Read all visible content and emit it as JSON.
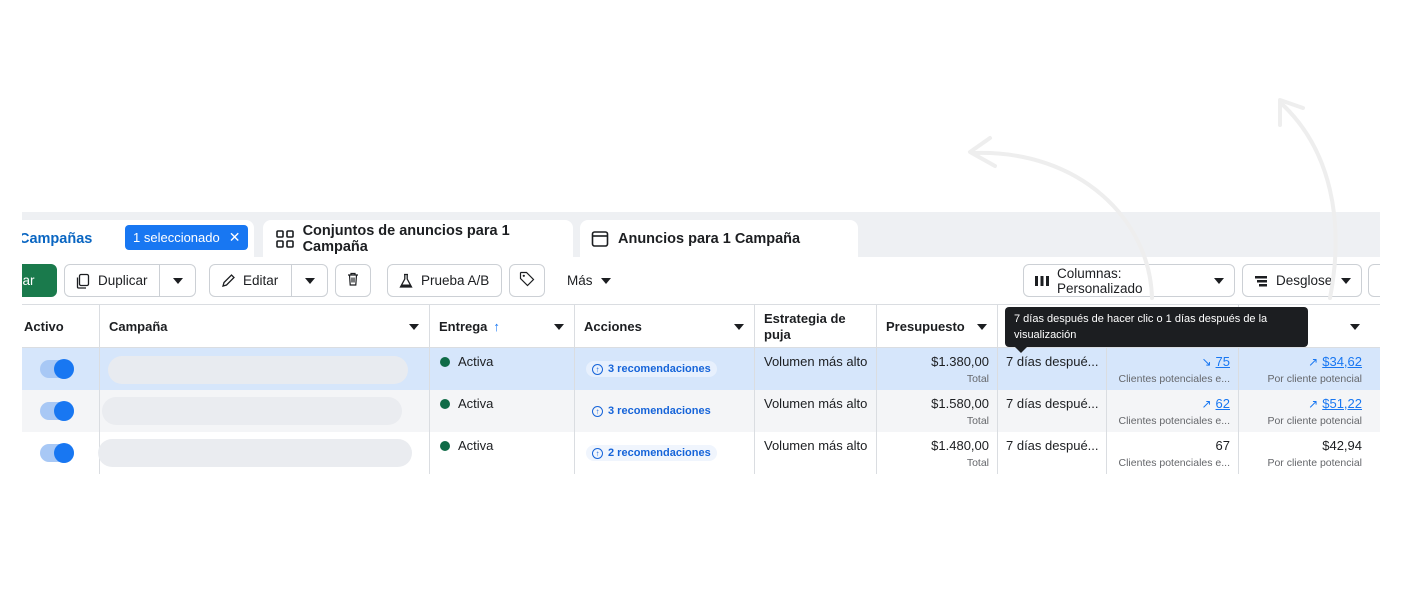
{
  "tabs": {
    "campaigns": "Campañas",
    "selected_badge": "1 seleccionado",
    "adsets": "Conjuntos de anuncios para 1 Campaña",
    "ads": "Anuncios para 1 Campaña"
  },
  "toolbar": {
    "create": "ear",
    "duplicate": "Duplicar",
    "edit": "Editar",
    "ab_test": "Prueba A/B",
    "more": "Más",
    "columns": "Columnas: Personalizado",
    "breakdown": "Desglose"
  },
  "table": {
    "headers": {
      "active": "Activo",
      "campaign": "Campaña",
      "delivery": "Entrega",
      "actions": "Acciones",
      "bid_strategy": "Estrategia de puja",
      "budget": "Presupuesto"
    },
    "rows": [
      {
        "delivery": "Activa",
        "actions": "3 recomendaciones",
        "bid": "Volumen más alto",
        "budget": "$1.380,00",
        "budget_sub": "Total",
        "attribution": "7 días despué...",
        "results": "75",
        "results_sub": "Clientes potenciales e...",
        "cost": "$34,62",
        "cost_sub": "Por cliente potencial"
      },
      {
        "delivery": "Activa",
        "actions": "3 recomendaciones",
        "bid": "Volumen más alto",
        "budget": "$1.580,00",
        "budget_sub": "Total",
        "attribution": "7 días despué...",
        "results": "62",
        "results_sub": "Clientes potenciales e...",
        "cost": "$51,22",
        "cost_sub": "Por cliente potencial"
      },
      {
        "delivery": "Activa",
        "actions": "2 recomendaciones",
        "bid": "Volumen más alto",
        "budget": "$1.480,00",
        "budget_sub": "Total",
        "attribution": "7 días despué...",
        "results": "67",
        "results_sub": "Clientes potenciales e...",
        "cost": "$42,94",
        "cost_sub": "Por cliente potencial"
      }
    ]
  },
  "tooltip": "7 días después de hacer clic o 1 días después de la visualización",
  "colors": {
    "accent": "#1877f2",
    "selected_row": "#d6e6fb",
    "status_active": "#0f6b47",
    "create_button": "#1a7a4c"
  }
}
